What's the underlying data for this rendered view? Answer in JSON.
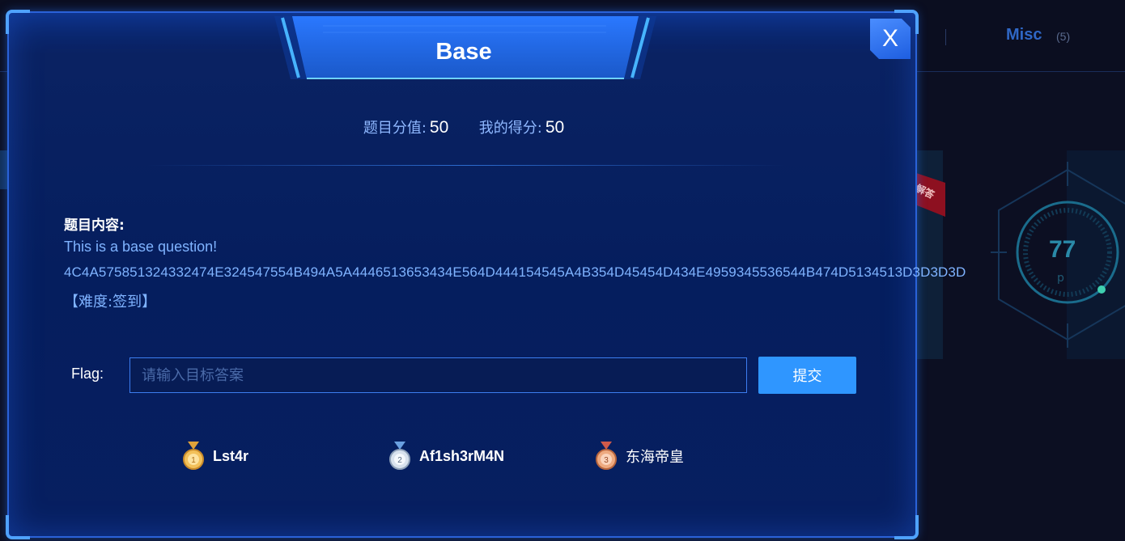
{
  "background": {
    "category_tab": {
      "label": "Misc",
      "count": "(5)"
    },
    "ribbon_text": "解答",
    "score_ring": {
      "value": "77",
      "suffix": "p"
    }
  },
  "modal": {
    "title": "Base",
    "close_label": "X",
    "score": {
      "value_label": "题目分值:",
      "value": "50",
      "my_label": "我的得分:",
      "my_value": "50"
    },
    "content": {
      "label": "题目内容:",
      "line1": "This is a base question!",
      "line2": "4C4A575851324332474E324547554B494A5A4446513653434E564D444154545A4B354D45454D434E4959345536544B474D5134513D3D3D3D",
      "line3": "【难度:签到】"
    },
    "flag": {
      "label": "Flag:",
      "value": "",
      "placeholder": "请输入目标答案",
      "submit_label": "提交"
    },
    "top_solvers": [
      {
        "rank": "1",
        "name": "Lst4r",
        "medal_color": "#d9a441"
      },
      {
        "rank": "2",
        "name": "Af1sh3rM4N",
        "medal_color": "#b8c6d8"
      },
      {
        "rank": "3",
        "name": "东海帝皇",
        "medal_color": "#d98a5a"
      }
    ]
  }
}
